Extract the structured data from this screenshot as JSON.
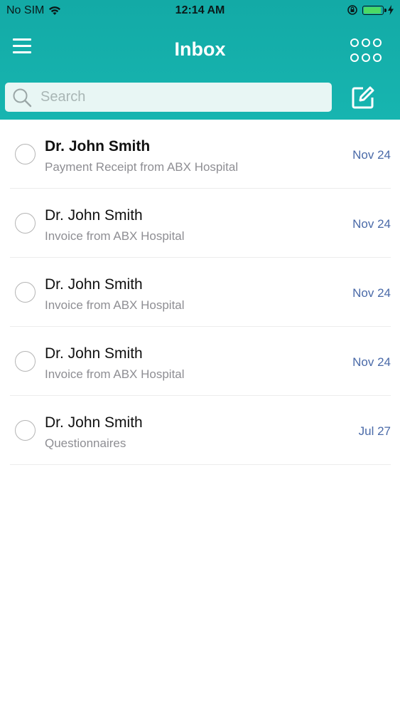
{
  "status_bar": {
    "carrier": "No SIM",
    "time": "12:14 AM",
    "battery_color": "#4cd964"
  },
  "header": {
    "title": "Inbox",
    "background": "#15b0ab",
    "menu_icon": "hamburger-menu-icon",
    "grid_icon": "six-dots-grid-icon",
    "compose_icon": "compose-icon"
  },
  "search": {
    "placeholder": "Search",
    "value": ""
  },
  "messages": [
    {
      "sender": "Dr. John Smith",
      "subject": "Payment Receipt from ABX Hospital",
      "date": "Nov 24",
      "unread": true
    },
    {
      "sender": "Dr. John Smith",
      "subject": "Invoice from ABX Hospital",
      "date": "Nov 24",
      "unread": false
    },
    {
      "sender": "Dr. John Smith",
      "subject": "Invoice from ABX Hospital",
      "date": "Nov 24",
      "unread": false
    },
    {
      "sender": "Dr. John Smith",
      "subject": "Invoice from ABX Hospital",
      "date": "Nov 24",
      "unread": false
    },
    {
      "sender": "Dr. John Smith",
      "subject": "Questionnaires",
      "date": "Jul 27",
      "unread": false
    }
  ],
  "colors": {
    "accent": "#15b0ab",
    "date": "#4a6aa8",
    "subject": "#8e8e93"
  }
}
